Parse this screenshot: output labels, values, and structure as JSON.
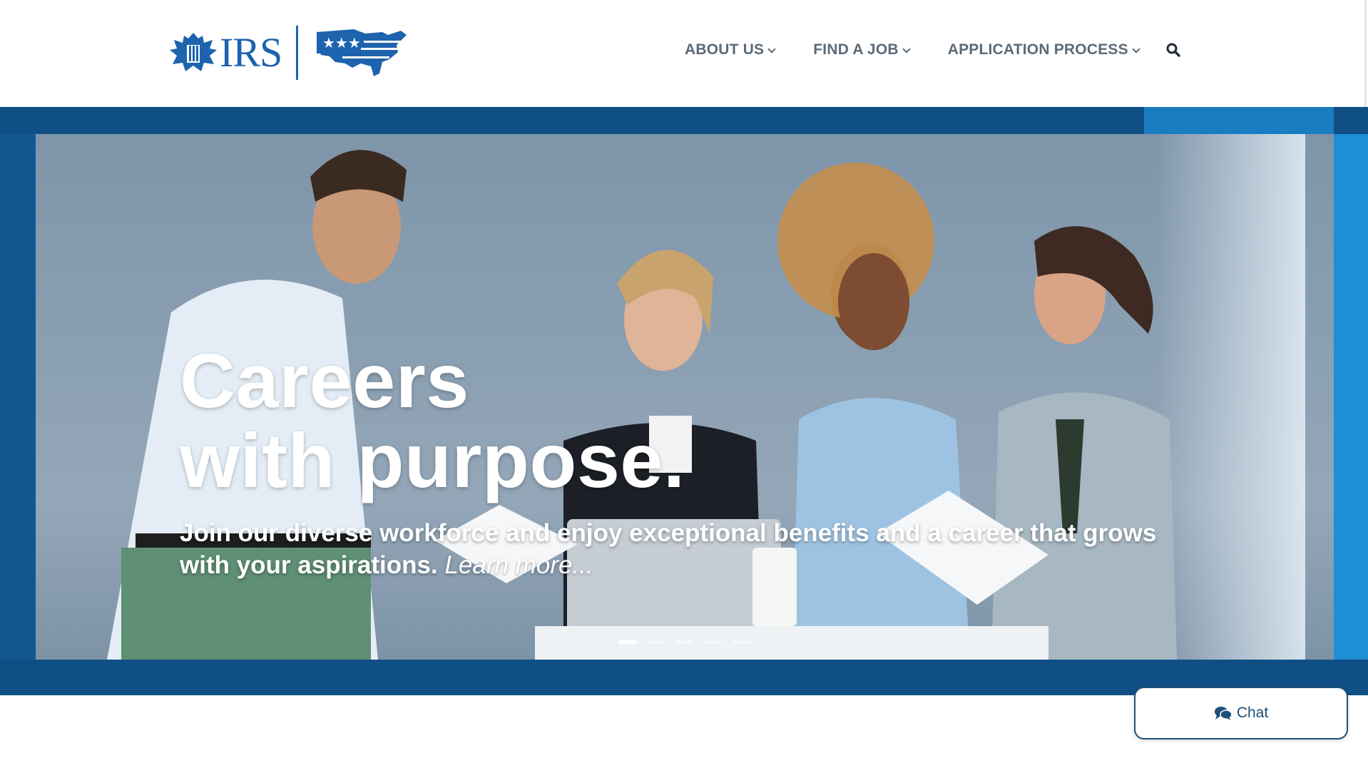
{
  "header": {
    "logo_text": "IRS",
    "nav": [
      {
        "label": "ABOUT US"
      },
      {
        "label": "FIND A JOB"
      },
      {
        "label": "APPLICATION PROCESS"
      }
    ],
    "search_icon": "search-icon"
  },
  "hero": {
    "title_line1": "Careers",
    "title_line2": "with purpose.",
    "subtitle": "Join our diverse workforce and enjoy exceptional benefits and a career that grows with your aspirations.",
    "learn_more": "Learn more...",
    "slides_total": 5,
    "slide_active": 1
  },
  "chat": {
    "label": "Chat",
    "icon": "chat-bubbles-icon"
  },
  "colors": {
    "brand_blue": "#1d63ae",
    "nav_text": "#5a6a79",
    "hero_band": "#0f4f85",
    "chat_border": "#1d4f78"
  }
}
